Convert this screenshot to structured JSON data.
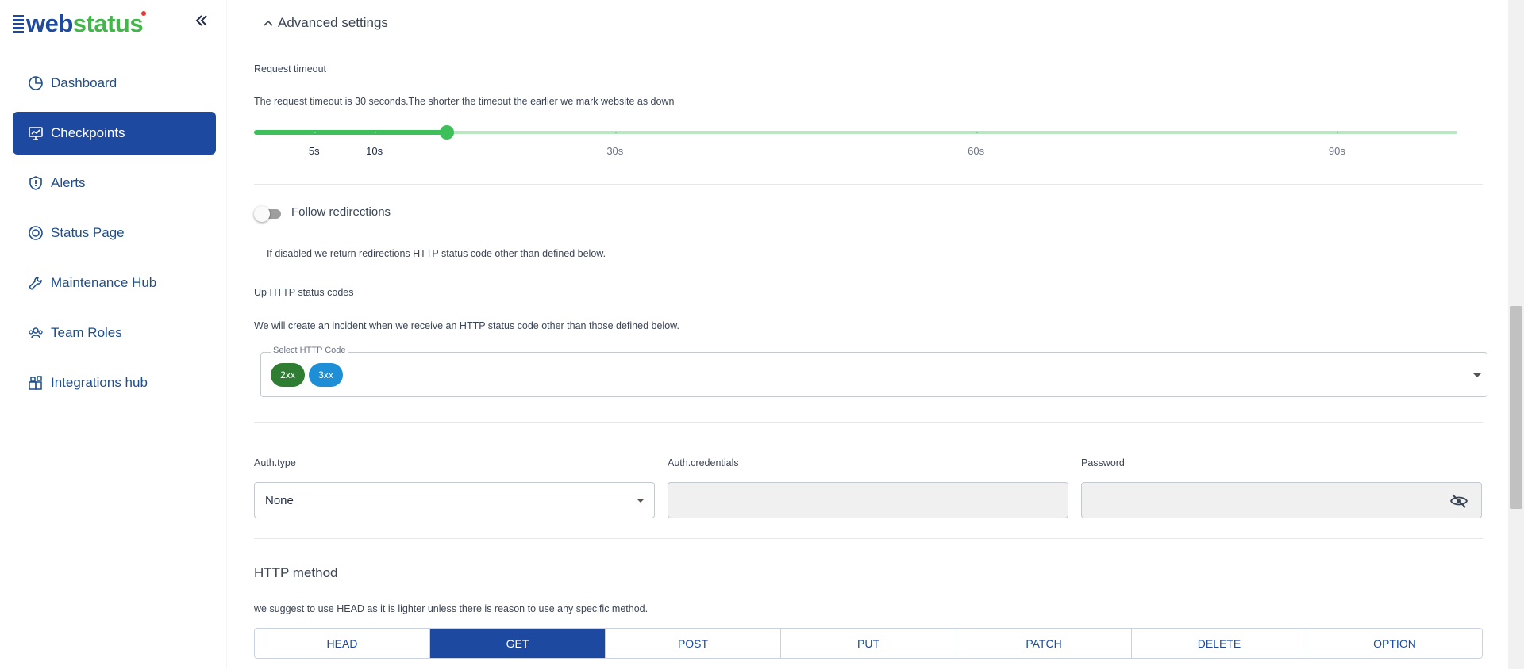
{
  "brand": {
    "logo_web": "web",
    "logo_status": "status",
    "collapse_icon": "double-chevron-left-icon"
  },
  "sidebar": {
    "items": [
      {
        "label": "Dashboard",
        "icon": "pie-chart-icon",
        "active": false
      },
      {
        "label": "Checkpoints",
        "icon": "monitor-chart-icon",
        "active": true
      },
      {
        "label": "Alerts",
        "icon": "shield-alert-icon",
        "active": false
      },
      {
        "label": "Status Page",
        "icon": "status-page-icon",
        "active": false
      },
      {
        "label": "Maintenance Hub",
        "icon": "wrench-icon",
        "active": false
      },
      {
        "label": "Team Roles",
        "icon": "team-icon",
        "active": false
      },
      {
        "label": "Integrations hub",
        "icon": "integrations-icon",
        "active": false
      }
    ]
  },
  "advanced": {
    "header": "Advanced settings",
    "request_timeout": {
      "label": "Request timeout",
      "description": "The request timeout is 30 seconds.The shorter the timeout the earlier we mark website as down",
      "slider": {
        "min": 0,
        "max": 100,
        "value": 16,
        "marks": [
          {
            "value": 5,
            "label": "5s"
          },
          {
            "value": 10,
            "label": "10s"
          },
          {
            "value": 30,
            "label": "30s"
          },
          {
            "value": 60,
            "label": "60s"
          },
          {
            "value": 90,
            "label": "90s"
          }
        ]
      }
    },
    "follow_redirections": {
      "label": "Follow redirections",
      "enabled": false,
      "description": "If disabled we return redirections HTTP status code other than defined below."
    },
    "up_http_status_codes": {
      "label": "Up HTTP status codes",
      "description": "We will create an incident when we receive an HTTP status code other than those defined below.",
      "select_label": "Select HTTP Code",
      "chips": [
        "2xx",
        "3xx"
      ]
    },
    "auth": {
      "type_label": "Auth.type",
      "type_value": "None",
      "credentials_label": "Auth.credentials",
      "credentials_value": "",
      "password_label": "Password",
      "password_value": "",
      "password_icon": "eye-off-icon"
    },
    "http_method": {
      "title": "HTTP method",
      "description": "we suggest to use HEAD as it is lighter unless there is reason to use any specific method.",
      "options": [
        "HEAD",
        "GET",
        "POST",
        "PUT",
        "PATCH",
        "DELETE",
        "OPTION"
      ],
      "selected": "GET"
    }
  },
  "colors": {
    "primary": "#1d4aa0",
    "success": "#3fbf5a",
    "chip_2xx": "#2e7d32",
    "chip_3xx": "#1e8fd6"
  }
}
